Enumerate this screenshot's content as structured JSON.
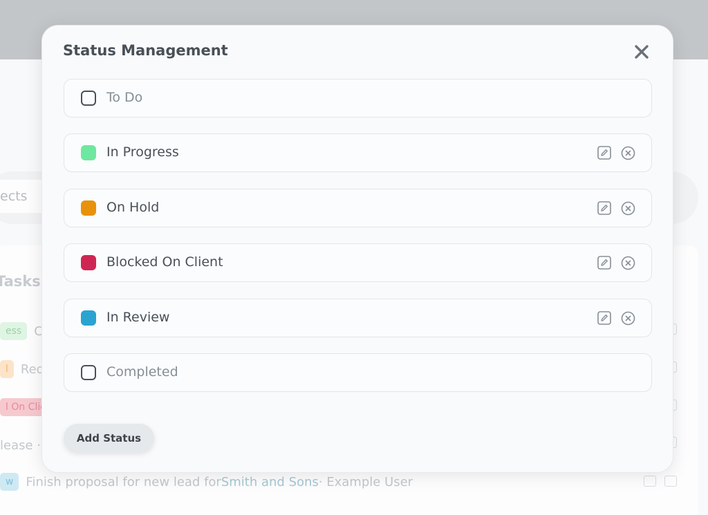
{
  "background": {
    "search_text": "ects",
    "tasks_title": "Tasks",
    "rows": [
      {
        "badge": "ess",
        "badge_bg": "#dff5e3",
        "badge_color": "#9fcfa9",
        "text": "C"
      },
      {
        "badge": "l",
        "badge_bg": "#fde3c8",
        "badge_color": "#f0b87a",
        "text": "Red"
      },
      {
        "badge": "l On Clie",
        "badge_bg": "#f6c9cf",
        "badge_color": "#e68a97",
        "text": ""
      },
      {
        "badge": "",
        "badge_bg": "",
        "badge_color": "",
        "text": "lease ·"
      },
      {
        "badge": "w",
        "badge_bg": "#cfe9f3",
        "badge_color": "#7fc1db",
        "text": "Finish proposal for new lead for ",
        "link": "Smith and Sons",
        "suffix": " · Example User"
      }
    ]
  },
  "modal": {
    "title": "Status Management",
    "close_icon": "close-icon",
    "statuses": [
      {
        "label": "To Do",
        "color": null,
        "editable": false
      },
      {
        "label": "In Progress",
        "color": "#6ee7a0",
        "editable": true
      },
      {
        "label": "On Hold",
        "color": "#e8920b",
        "editable": true
      },
      {
        "label": "Blocked On Client",
        "color": "#cf2553",
        "editable": true
      },
      {
        "label": "In Review",
        "color": "#2aa3d1",
        "editable": true
      },
      {
        "label": "Completed",
        "color": null,
        "editable": false
      }
    ],
    "add_button": "Add Status"
  }
}
